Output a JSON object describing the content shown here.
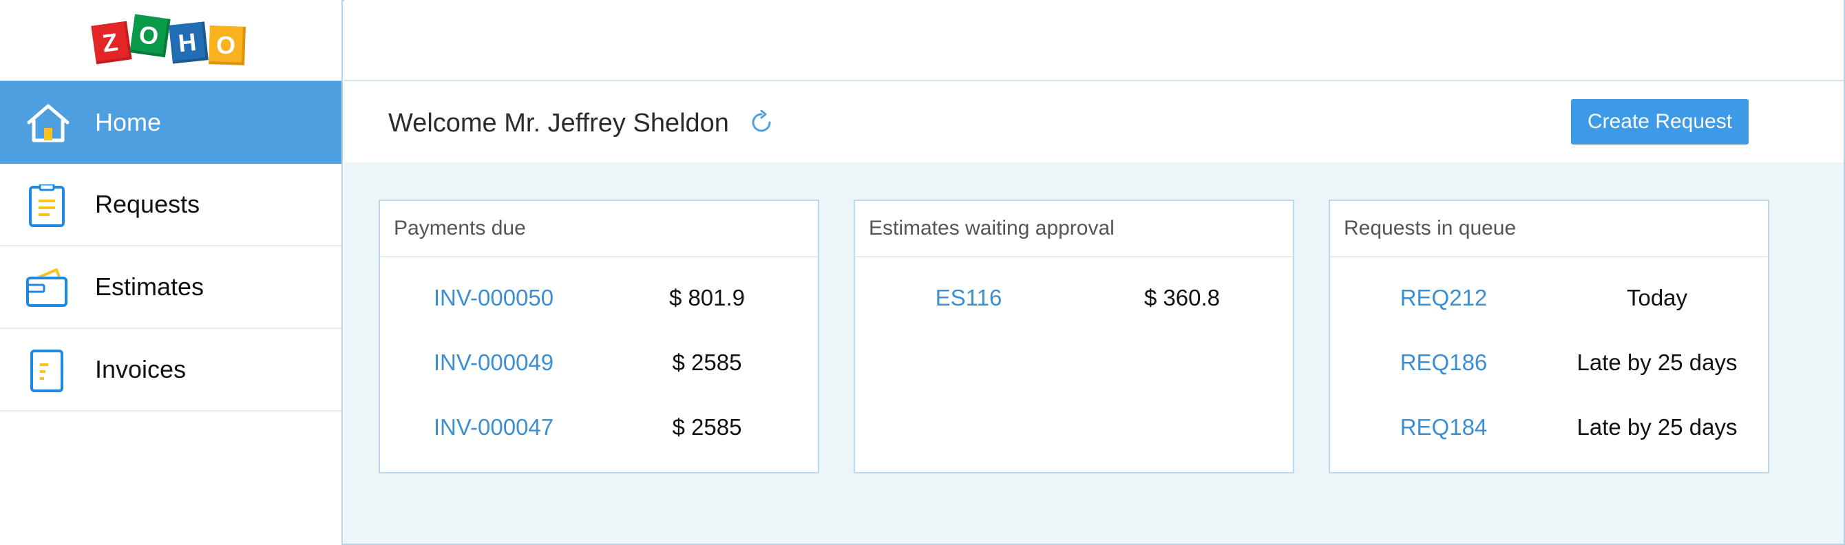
{
  "brand": {
    "logo_letters": [
      "Z",
      "O",
      "H",
      "O"
    ],
    "logo_colors": [
      "#e42527",
      "#089949",
      "#226db4",
      "#f9b21d"
    ]
  },
  "sidebar": {
    "items": [
      {
        "label": "Home",
        "icon": "home-icon",
        "active": true
      },
      {
        "label": "Requests",
        "icon": "clipboard-icon",
        "active": false
      },
      {
        "label": "Estimates",
        "icon": "wallet-icon",
        "active": false
      },
      {
        "label": "Invoices",
        "icon": "document-icon",
        "active": false
      }
    ]
  },
  "header": {
    "welcome": "Welcome Mr. Jeffrey Sheldon",
    "refresh_icon": "refresh-icon",
    "create_button": "Create Request"
  },
  "cards": [
    {
      "title": "Payments due",
      "rows": [
        {
          "id": "INV-000050",
          "value": "$ 801.9"
        },
        {
          "id": "INV-000049",
          "value": "$ 2585"
        },
        {
          "id": "INV-000047",
          "value": "$ 2585"
        }
      ]
    },
    {
      "title": "Estimates waiting approval",
      "rows": [
        {
          "id": "ES116",
          "value": "$ 360.8"
        }
      ]
    },
    {
      "title": "Requests in queue",
      "rows": [
        {
          "id": "REQ212",
          "value": "Today"
        },
        {
          "id": "REQ186",
          "value": "Late by 25 days"
        },
        {
          "id": "REQ184",
          "value": "Late by 25 days"
        }
      ]
    }
  ],
  "colors": {
    "accent": "#3c9ae6",
    "sidebar_active": "#4e9fe0",
    "link": "#3d8fd3",
    "content_bg": "#edf5f9",
    "border": "#b9d8ef",
    "icon_blue": "#1e88e5",
    "icon_yellow": "#f9c21d"
  }
}
